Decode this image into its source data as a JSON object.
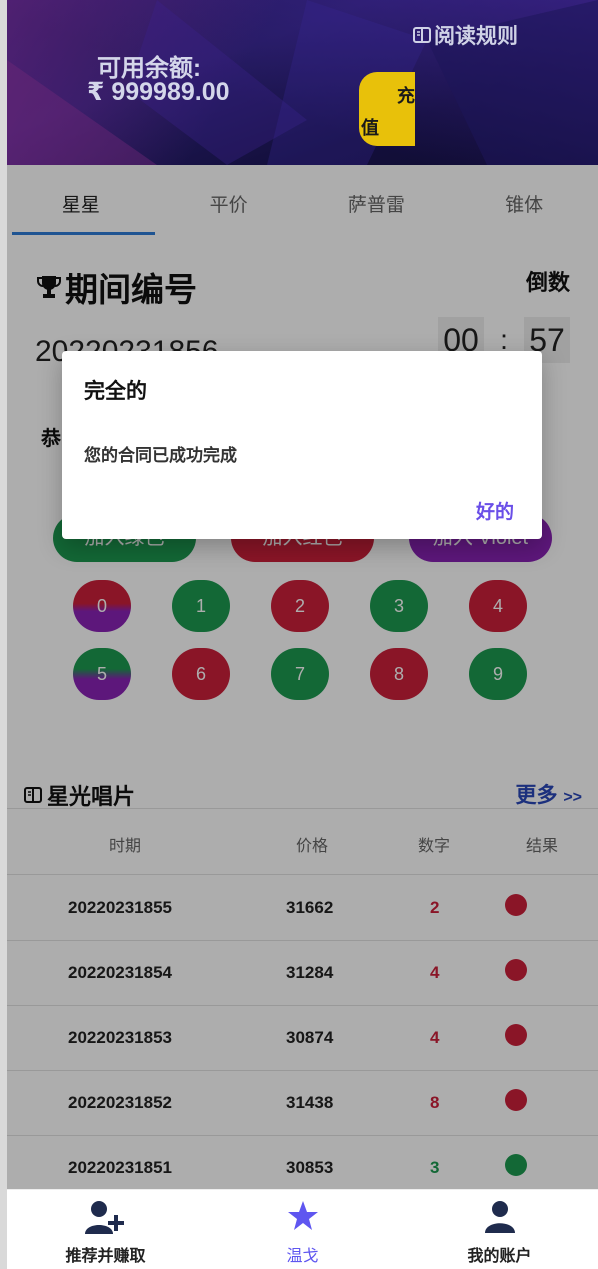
{
  "header": {
    "rules_label": "阅读规则",
    "balance_label": "可用余额:",
    "balance_value": "₹ 999989.00",
    "recharge_part1": "充",
    "recharge_part2": "值"
  },
  "tabs": [
    {
      "label": "星星",
      "active": true
    },
    {
      "label": "平价",
      "active": false
    },
    {
      "label": "萨普雷",
      "active": false
    },
    {
      "label": "锥体",
      "active": false
    }
  ],
  "game": {
    "period_label": "期间编号",
    "countdown_label": "倒数",
    "period_number": "20220231856",
    "timer": {
      "min": "00",
      "sep": ":",
      "sec": "57"
    },
    "congrats_prefix": "恭",
    "join_buttons": [
      "加入绿色",
      "加入红色",
      "加入 Violet"
    ],
    "numbers": [
      {
        "n": "0",
        "color": "red-violet"
      },
      {
        "n": "1",
        "color": "green"
      },
      {
        "n": "2",
        "color": "red"
      },
      {
        "n": "3",
        "color": "green"
      },
      {
        "n": "4",
        "color": "red"
      },
      {
        "n": "5",
        "color": "green-violet"
      },
      {
        "n": "6",
        "color": "red"
      },
      {
        "n": "7",
        "color": "green"
      },
      {
        "n": "8",
        "color": "red"
      },
      {
        "n": "9",
        "color": "green"
      }
    ]
  },
  "records": {
    "title": "星光唱片",
    "more": "更多",
    "more_arrows": ">>",
    "columns": [
      "时期",
      "价格",
      "数字",
      "结果"
    ],
    "rows": [
      {
        "period": "20220231855",
        "price": "31662",
        "number": "2",
        "result": "red"
      },
      {
        "period": "20220231854",
        "price": "31284",
        "number": "4",
        "result": "red"
      },
      {
        "period": "20220231853",
        "price": "30874",
        "number": "4",
        "result": "red"
      },
      {
        "period": "20220231852",
        "price": "31438",
        "number": "8",
        "result": "red"
      },
      {
        "period": "20220231851",
        "price": "30853",
        "number": "3",
        "result": "green"
      }
    ]
  },
  "nav": [
    {
      "label": "推荐并赚取",
      "icon": "add-user-icon",
      "active": false
    },
    {
      "label": "温戈",
      "icon": "star-icon",
      "active": true
    },
    {
      "label": "我的账户",
      "icon": "user-icon",
      "active": false
    }
  ],
  "dialog": {
    "title": "完全的",
    "message": "您的合同已成功完成",
    "ok": "好的"
  },
  "colors": {
    "green": "#1c9a50",
    "red": "#cc1f3a",
    "violet": "#8a22b5",
    "accent": "#5f56f0",
    "recharge": "#e8c10a"
  }
}
